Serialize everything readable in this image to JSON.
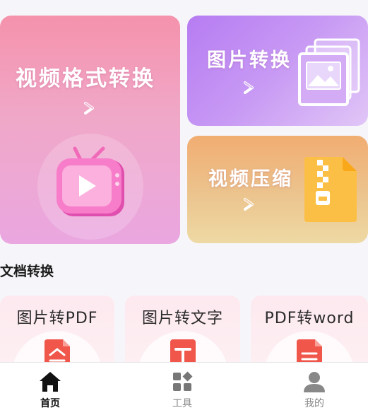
{
  "features": {
    "video_convert": {
      "title": "视频格式转换",
      "icon": "tv-play-icon"
    },
    "image_convert": {
      "title": "图片转换",
      "icon": "photo-stack-icon"
    },
    "video_compress": {
      "title": "视频压缩",
      "icon": "zip-file-icon"
    }
  },
  "section": {
    "title": "文档转换"
  },
  "documents": [
    {
      "label": "图片转PDF",
      "icon": "pdf-file-icon"
    },
    {
      "label": "图片转文字",
      "icon": "text-t-icon"
    },
    {
      "label": "PDF转word",
      "icon": "doc-file-icon"
    }
  ],
  "tabbar": {
    "items": [
      {
        "label": "首页",
        "icon": "home-icon",
        "active": true
      },
      {
        "label": "工具",
        "icon": "tools-grid-icon",
        "active": false
      },
      {
        "label": "我的",
        "icon": "user-icon",
        "active": false
      }
    ]
  },
  "colors": {
    "accent_pink": "#f592ac",
    "accent_purple": "#b67cf2",
    "accent_orange": "#f1ad72",
    "doc_icon_red": "#f0564a",
    "background": "#f6f6fa"
  }
}
